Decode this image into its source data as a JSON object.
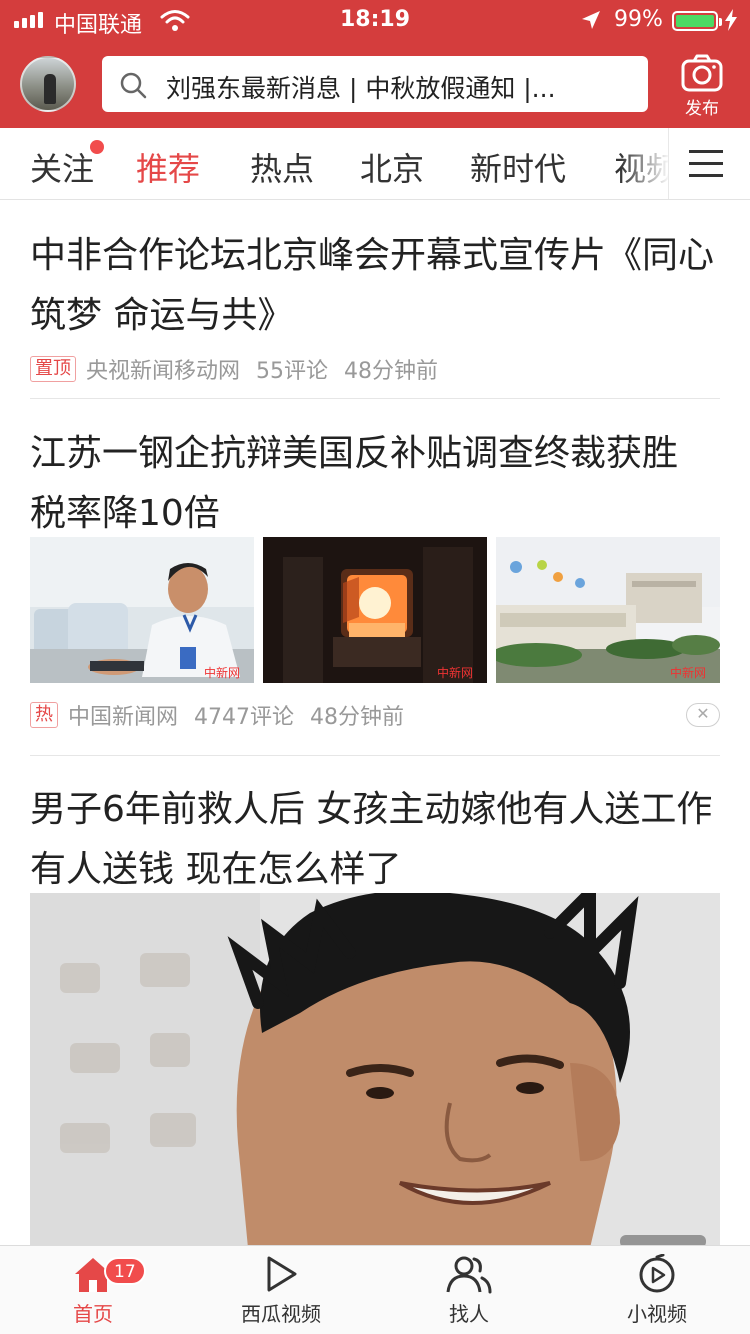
{
  "status_bar": {
    "carrier": "中国联通",
    "time": "18:19",
    "battery_pct": "99%",
    "battery_level": 0.99
  },
  "header": {
    "search_placeholder": "刘强东最新消息 | 中秋放假通知 |...",
    "publish_label": "发布",
    "icons": [
      "search-icon",
      "camera-icon"
    ]
  },
  "channels": {
    "items": [
      {
        "label": "关注",
        "has_dot": true
      },
      {
        "label": "推荐",
        "active": true
      },
      {
        "label": "热点"
      },
      {
        "label": "北京"
      },
      {
        "label": "新时代"
      },
      {
        "label": "视频"
      }
    ]
  },
  "feed": [
    {
      "title": "中非合作论坛北京峰会开幕式宣传片《同心筑梦 命运与共》",
      "tag": "置顶",
      "source": "央视新闻移动网",
      "comments": "55评论",
      "time": "48分钟前"
    },
    {
      "title": "江苏一钢企抗辩美国反补贴调查终裁获胜 税率降10倍",
      "tag": "热",
      "source": "中国新闻网",
      "comments": "4747评论",
      "time": "48分钟前",
      "watermark": "中新网"
    },
    {
      "title": "男子6年前救人后 女孩主动嫁他有人送工作有人送钱 现在怎么样了"
    }
  ],
  "tabbar": {
    "items": [
      {
        "label": "首页",
        "icon": "home-icon",
        "active": true,
        "badge": "17"
      },
      {
        "label": "西瓜视频",
        "icon": "play-icon"
      },
      {
        "label": "找人",
        "icon": "people-icon"
      },
      {
        "label": "小视频",
        "icon": "small-video-icon"
      }
    ]
  },
  "colors": {
    "brand": "#d43d3d",
    "accent": "#e54848",
    "battery": "#4cd964"
  }
}
